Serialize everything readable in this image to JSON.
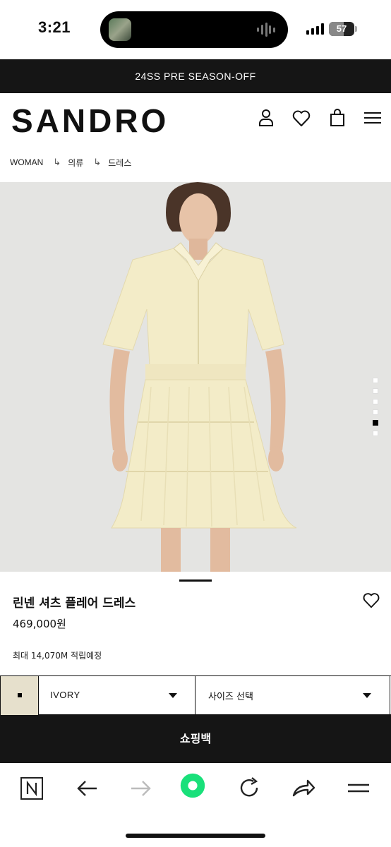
{
  "status_bar": {
    "time": "3:21",
    "battery": "57",
    "battery_fill_percent": 57
  },
  "promo": {
    "text": "24SS PRE SEASON-OFF"
  },
  "header": {
    "logo": "SANDRO",
    "icons": [
      "account-icon",
      "heart-icon",
      "bag-icon",
      "menu-icon"
    ]
  },
  "breadcrumb": {
    "items": [
      "WOMAN",
      "의류",
      "드레스"
    ],
    "separator": "↳"
  },
  "gallery": {
    "dot_count": 6,
    "active_index": 4
  },
  "product": {
    "name": "린넨 셔츠 플레어 드레스",
    "price": "469,000원",
    "points": "최대 14,070M 적립예정"
  },
  "selectors": {
    "color_name": "IVORY",
    "size_placeholder": "사이즈 선택"
  },
  "actions": {
    "bag_label": "쇼핑백"
  },
  "browser_toolbar": {
    "icons": [
      "naver-n-icon",
      "back-arrow-icon",
      "forward-arrow-icon",
      "green-dot-icon",
      "refresh-icon",
      "share-icon",
      "menu-icon"
    ],
    "accent": "#19e07a"
  },
  "colors": {
    "dark": "#151515",
    "swatch": "#e6e0cc",
    "image_bg": "#e4e4e2"
  }
}
